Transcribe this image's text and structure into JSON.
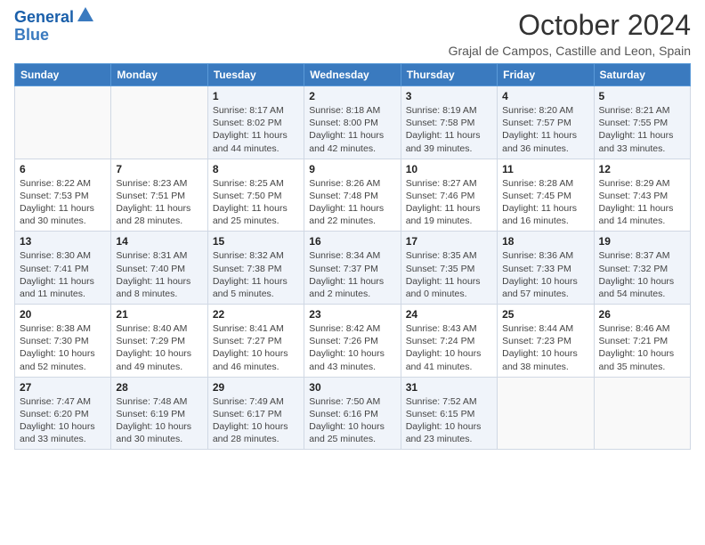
{
  "header": {
    "logo_line1": "General",
    "logo_line2": "Blue",
    "month_title": "October 2024",
    "subtitle": "Grajal de Campos, Castille and Leon, Spain"
  },
  "weekdays": [
    "Sunday",
    "Monday",
    "Tuesday",
    "Wednesday",
    "Thursday",
    "Friday",
    "Saturday"
  ],
  "weeks": [
    [
      {
        "day": "",
        "info": ""
      },
      {
        "day": "",
        "info": ""
      },
      {
        "day": "1",
        "info": "Sunrise: 8:17 AM\nSunset: 8:02 PM\nDaylight: 11 hours and 44 minutes."
      },
      {
        "day": "2",
        "info": "Sunrise: 8:18 AM\nSunset: 8:00 PM\nDaylight: 11 hours and 42 minutes."
      },
      {
        "day": "3",
        "info": "Sunrise: 8:19 AM\nSunset: 7:58 PM\nDaylight: 11 hours and 39 minutes."
      },
      {
        "day": "4",
        "info": "Sunrise: 8:20 AM\nSunset: 7:57 PM\nDaylight: 11 hours and 36 minutes."
      },
      {
        "day": "5",
        "info": "Sunrise: 8:21 AM\nSunset: 7:55 PM\nDaylight: 11 hours and 33 minutes."
      }
    ],
    [
      {
        "day": "6",
        "info": "Sunrise: 8:22 AM\nSunset: 7:53 PM\nDaylight: 11 hours and 30 minutes."
      },
      {
        "day": "7",
        "info": "Sunrise: 8:23 AM\nSunset: 7:51 PM\nDaylight: 11 hours and 28 minutes."
      },
      {
        "day": "8",
        "info": "Sunrise: 8:25 AM\nSunset: 7:50 PM\nDaylight: 11 hours and 25 minutes."
      },
      {
        "day": "9",
        "info": "Sunrise: 8:26 AM\nSunset: 7:48 PM\nDaylight: 11 hours and 22 minutes."
      },
      {
        "day": "10",
        "info": "Sunrise: 8:27 AM\nSunset: 7:46 PM\nDaylight: 11 hours and 19 minutes."
      },
      {
        "day": "11",
        "info": "Sunrise: 8:28 AM\nSunset: 7:45 PM\nDaylight: 11 hours and 16 minutes."
      },
      {
        "day": "12",
        "info": "Sunrise: 8:29 AM\nSunset: 7:43 PM\nDaylight: 11 hours and 14 minutes."
      }
    ],
    [
      {
        "day": "13",
        "info": "Sunrise: 8:30 AM\nSunset: 7:41 PM\nDaylight: 11 hours and 11 minutes."
      },
      {
        "day": "14",
        "info": "Sunrise: 8:31 AM\nSunset: 7:40 PM\nDaylight: 11 hours and 8 minutes."
      },
      {
        "day": "15",
        "info": "Sunrise: 8:32 AM\nSunset: 7:38 PM\nDaylight: 11 hours and 5 minutes."
      },
      {
        "day": "16",
        "info": "Sunrise: 8:34 AM\nSunset: 7:37 PM\nDaylight: 11 hours and 2 minutes."
      },
      {
        "day": "17",
        "info": "Sunrise: 8:35 AM\nSunset: 7:35 PM\nDaylight: 11 hours and 0 minutes."
      },
      {
        "day": "18",
        "info": "Sunrise: 8:36 AM\nSunset: 7:33 PM\nDaylight: 10 hours and 57 minutes."
      },
      {
        "day": "19",
        "info": "Sunrise: 8:37 AM\nSunset: 7:32 PM\nDaylight: 10 hours and 54 minutes."
      }
    ],
    [
      {
        "day": "20",
        "info": "Sunrise: 8:38 AM\nSunset: 7:30 PM\nDaylight: 10 hours and 52 minutes."
      },
      {
        "day": "21",
        "info": "Sunrise: 8:40 AM\nSunset: 7:29 PM\nDaylight: 10 hours and 49 minutes."
      },
      {
        "day": "22",
        "info": "Sunrise: 8:41 AM\nSunset: 7:27 PM\nDaylight: 10 hours and 46 minutes."
      },
      {
        "day": "23",
        "info": "Sunrise: 8:42 AM\nSunset: 7:26 PM\nDaylight: 10 hours and 43 minutes."
      },
      {
        "day": "24",
        "info": "Sunrise: 8:43 AM\nSunset: 7:24 PM\nDaylight: 10 hours and 41 minutes."
      },
      {
        "day": "25",
        "info": "Sunrise: 8:44 AM\nSunset: 7:23 PM\nDaylight: 10 hours and 38 minutes."
      },
      {
        "day": "26",
        "info": "Sunrise: 8:46 AM\nSunset: 7:21 PM\nDaylight: 10 hours and 35 minutes."
      }
    ],
    [
      {
        "day": "27",
        "info": "Sunrise: 7:47 AM\nSunset: 6:20 PM\nDaylight: 10 hours and 33 minutes."
      },
      {
        "day": "28",
        "info": "Sunrise: 7:48 AM\nSunset: 6:19 PM\nDaylight: 10 hours and 30 minutes."
      },
      {
        "day": "29",
        "info": "Sunrise: 7:49 AM\nSunset: 6:17 PM\nDaylight: 10 hours and 28 minutes."
      },
      {
        "day": "30",
        "info": "Sunrise: 7:50 AM\nSunset: 6:16 PM\nDaylight: 10 hours and 25 minutes."
      },
      {
        "day": "31",
        "info": "Sunrise: 7:52 AM\nSunset: 6:15 PM\nDaylight: 10 hours and 23 minutes."
      },
      {
        "day": "",
        "info": ""
      },
      {
        "day": "",
        "info": ""
      }
    ]
  ]
}
